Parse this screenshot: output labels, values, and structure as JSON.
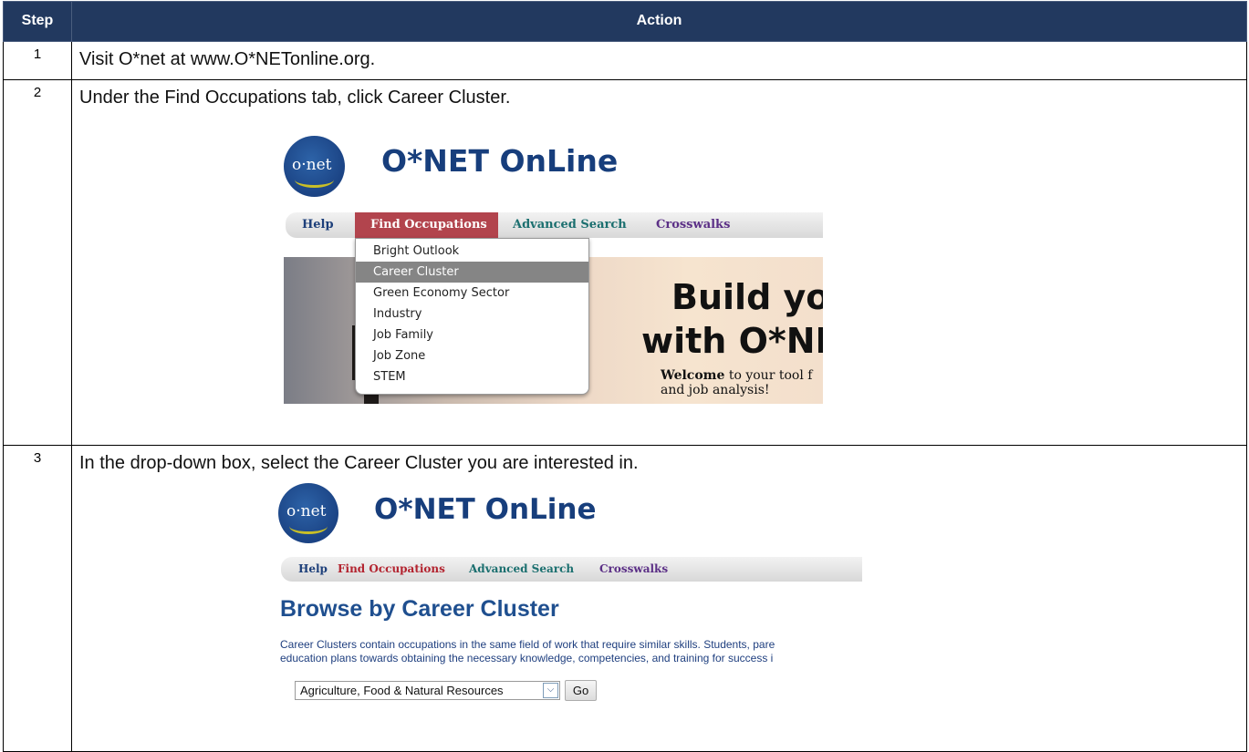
{
  "table": {
    "headers": {
      "step": "Step",
      "action": "Action"
    },
    "steps": [
      {
        "num": "1",
        "text": "Visit O*net at www.O*NETonline.org."
      },
      {
        "num": "2",
        "text": "Under the Find Occupations tab, click Career Cluster."
      },
      {
        "num": "3",
        "text": "In the drop-down box, select the Career Cluster you are interested in."
      }
    ]
  },
  "screenshot1": {
    "logo_text": "o·net",
    "site_title": "O*NET OnLine",
    "nav": [
      "Help",
      "Find Occupations",
      "Advanced Search",
      "Crosswalks"
    ],
    "menu_items": [
      "Bright Outlook",
      "Career Cluster",
      "Green Economy Sector",
      "Industry",
      "Job Family",
      "Job Zone",
      "STEM"
    ],
    "selected_menu_item": "Career Cluster",
    "banner": {
      "line1": "Build you",
      "line2": "with O*NET",
      "welcome_bold": "Welcome",
      "welcome_rest": "to your tool f",
      "welcome_line2": "and job analysis!"
    }
  },
  "screenshot2": {
    "logo_text": "o·net",
    "site_title": "O*NET OnLine",
    "nav": [
      "Help",
      "Find Occupations",
      "Advanced Search",
      "Crosswalks"
    ],
    "heading": "Browse by Career Cluster",
    "desc_line1": "Career Clusters contain occupations in the same field of work that require similar skills. Students, pare",
    "desc_line2": "education plans towards obtaining the necessary knowledge, competencies, and training for success i",
    "select_value": "Agriculture, Food & Natural Resources",
    "go_label": "Go"
  },
  "colors": {
    "header_bg": "#22395f",
    "nav_help": "#1d3f7a",
    "nav_find": "#b3232f",
    "nav_advanced": "#1b6f6f",
    "nav_crosswalks": "#5b2f86",
    "find_active_bg": "#b2444d"
  }
}
